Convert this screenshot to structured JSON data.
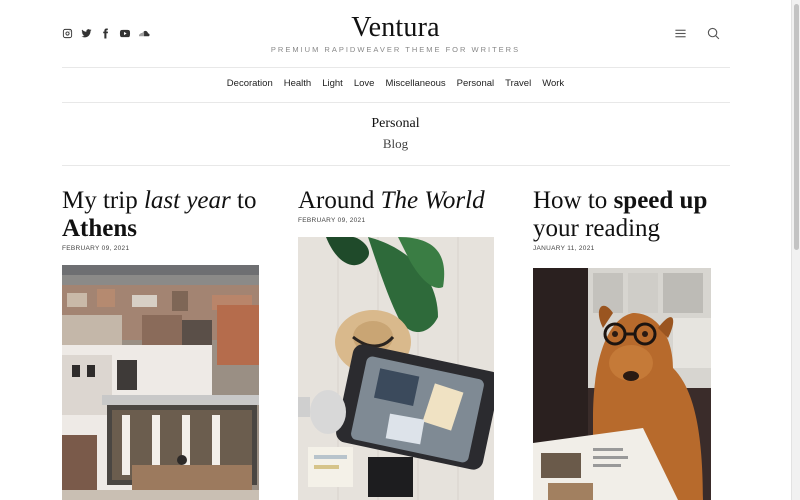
{
  "site": {
    "title": "Ventura",
    "tagline": "PREMIUM RAPIDWEAVER THEME FOR WRITERS"
  },
  "social_icons": [
    "instagram-icon",
    "twitter-icon",
    "facebook-icon",
    "youtube-icon",
    "soundcloud-icon"
  ],
  "header_tools": [
    "menu-icon",
    "search-icon"
  ],
  "nav": {
    "items": [
      "Decoration",
      "Health",
      "Light",
      "Love",
      "Miscellaneous",
      "Personal",
      "Travel",
      "Work"
    ]
  },
  "section": {
    "name": "Personal",
    "subtitle": "Blog"
  },
  "posts": [
    {
      "title_part1": "My trip ",
      "title_italic": "last year",
      "title_part2": " to ",
      "title_bold": "Athens",
      "date": "FEBRUARY 09, 2021",
      "image": "city-rooftops-photo"
    },
    {
      "title_part1": "Around ",
      "title_italic": "The World",
      "date": "FEBRUARY 09, 2021",
      "image": "suitcase-flatlay-photo"
    },
    {
      "title_part1": "How to ",
      "title_bold": "speed up",
      "title_part2": "your reading",
      "date": "JANUARY 11, 2021",
      "image": "dog-with-glasses-photo"
    }
  ]
}
